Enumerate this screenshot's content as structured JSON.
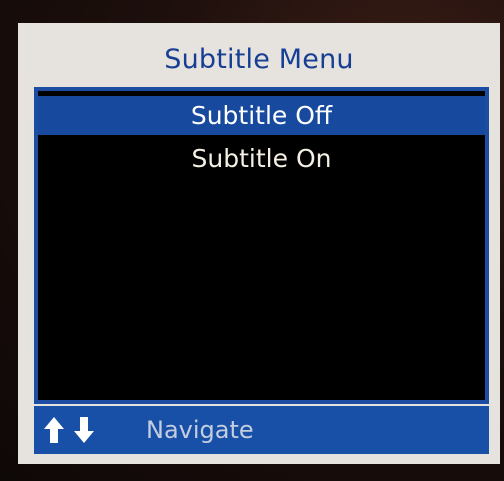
{
  "menu": {
    "title": "Subtitle Menu",
    "items": [
      {
        "label": "Subtitle Off",
        "selected": true
      },
      {
        "label": "Subtitle On",
        "selected": false
      }
    ]
  },
  "footer": {
    "icons": [
      "arrow-up-icon",
      "arrow-down-icon"
    ],
    "hint": "Navigate"
  },
  "colors": {
    "panel": "#e6e3de",
    "accent_blue": "#174a9e",
    "list_bg": "#000000",
    "title_text": "#163f94"
  }
}
